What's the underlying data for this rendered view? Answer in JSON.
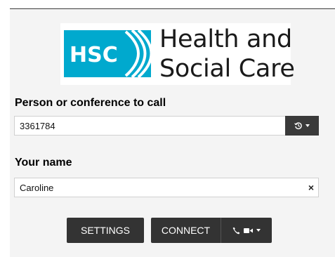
{
  "logo": {
    "badge_text": "HSC",
    "line1": "Health and",
    "line2": "Social Care",
    "brand_color": "#00a9ce"
  },
  "call_field": {
    "label": "Person or conference to call",
    "value": "3361784",
    "history_icon": "history-icon"
  },
  "name_field": {
    "label": "Your name",
    "value": "Caroline",
    "clear_label": "×"
  },
  "buttons": {
    "settings": "SETTINGS",
    "connect": "CONNECT",
    "mode_icons": [
      "phone-icon",
      "video-camera-icon"
    ]
  },
  "colors": {
    "button_bg": "#333333",
    "panel_bg": "#f4f4f4"
  }
}
